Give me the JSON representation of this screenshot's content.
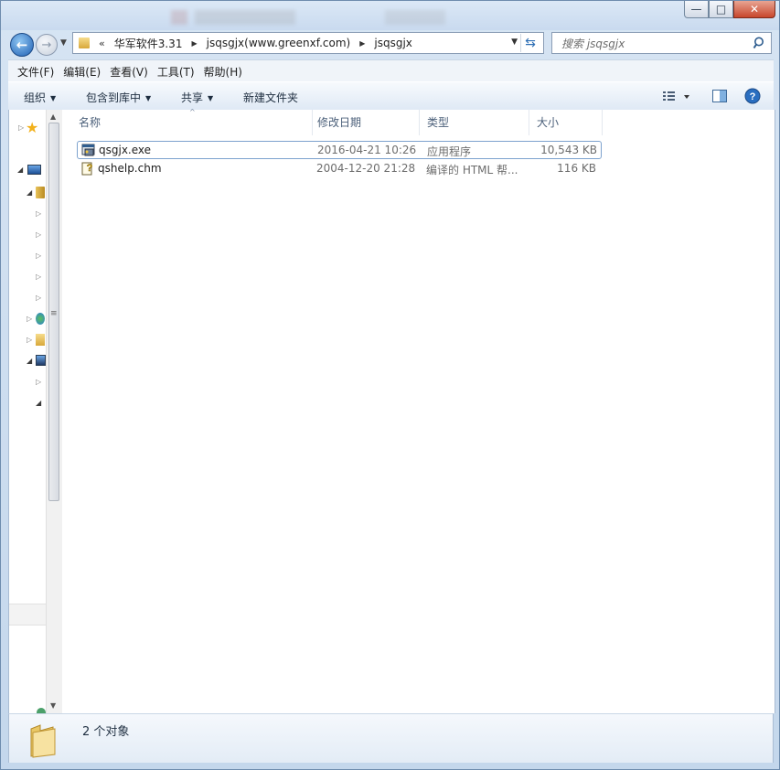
{
  "window": {
    "controls": {
      "minimize": "—",
      "maximize": "□",
      "close": "✕"
    }
  },
  "nav": {
    "back_icon": "back-arrow-icon",
    "forward_icon": "forward-arrow-icon",
    "overflow": "«",
    "breadcrumbs": [
      "华军软件3.31",
      "jsqsgjx(www.greenxf.com)",
      "jsqsgjx"
    ],
    "search_placeholder": "搜索 jsqsgjx"
  },
  "menu": [
    "文件(F)",
    "编辑(E)",
    "查看(V)",
    "工具(T)",
    "帮助(H)"
  ],
  "toolbar": {
    "organize": "组织",
    "include_in_library": "包含到库中",
    "share": "共享",
    "new_folder": "新建文件夹"
  },
  "columns": {
    "name": "名称",
    "modified": "修改日期",
    "type": "类型",
    "size": "大小"
  },
  "files": [
    {
      "name": "qsgjx.exe",
      "modified": "2016-04-21 10:26",
      "type": "应用程序",
      "size": "10,543 KB",
      "icon": "exe-application-icon",
      "selected": true
    },
    {
      "name": "qshelp.chm",
      "modified": "2004-12-20 21:28",
      "type": "编译的 HTML 帮...",
      "size": "116 KB",
      "icon": "chm-help-icon",
      "selected": false
    }
  ],
  "status": {
    "count_text": "2 个对象"
  },
  "colors": {
    "accent": "#1e5fb3",
    "selection_border": "#7da2ce",
    "header_text": "#4c607a"
  }
}
